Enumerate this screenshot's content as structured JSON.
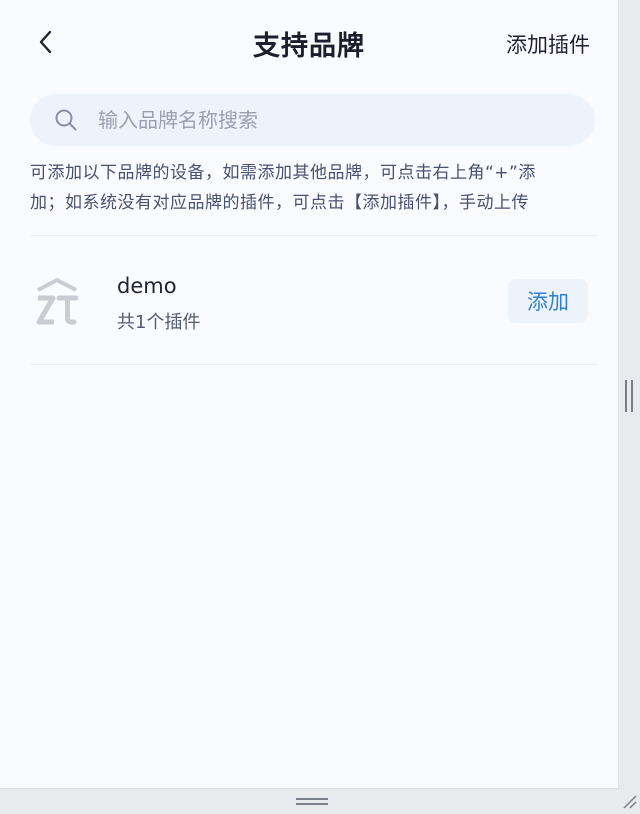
{
  "header": {
    "title": "支持品牌",
    "action_label": "添加插件"
  },
  "search": {
    "placeholder": "输入品牌名称搜索",
    "value": ""
  },
  "notice": {
    "line1": "可添加以下品牌的设备，如需添加其他品牌，可点击右上角“+”添",
    "line2": "加；如系统没有对应品牌的插件，可点击【添加插件】，手动上传"
  },
  "brands": [
    {
      "name": "demo",
      "count_label": "共1个插件",
      "logo_icon": "zt-logo-icon",
      "add_label": "添加"
    }
  ],
  "colors": {
    "accent": "#2e7fd6",
    "background": "#fafbfe",
    "search_bg": "#eef2fb",
    "notice_text": "#4a5070"
  }
}
